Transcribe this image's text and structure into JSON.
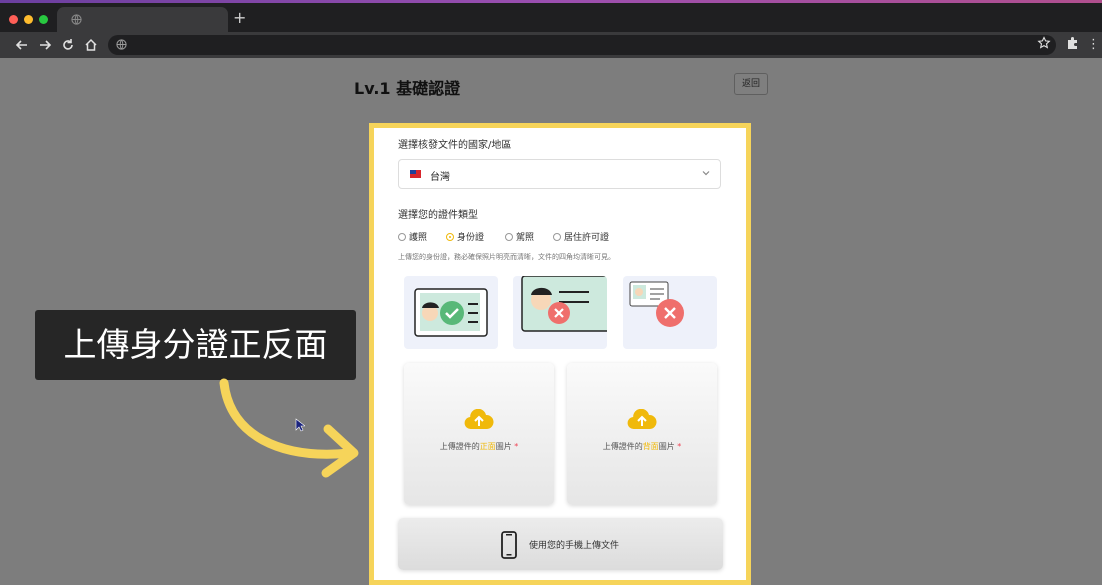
{
  "browser": {
    "tab_title": "",
    "new_tab_label": "+",
    "url": ""
  },
  "page": {
    "title": "Lv.1 基礎認證",
    "back_label": "返回"
  },
  "form": {
    "country_label": "選擇核發文件的國家/地區",
    "country_value": "台灣",
    "doc_type_label": "選擇您的證件類型",
    "doc_types": [
      "護照",
      "身份證",
      "駕照",
      "居住許可證"
    ],
    "selected_doc_type": "身份證",
    "hint": "上傳您的身份證，務必確保照片明亮而清晰，文件的四角均清晰可見。",
    "upload_front": {
      "prefix": "上傳證件的",
      "highlight": "正面",
      "suffix": "圖片",
      "required": "*"
    },
    "upload_back": {
      "prefix": "上傳證件的",
      "highlight": "背面",
      "suffix": "圖片",
      "required": "*"
    },
    "phone_upload_label": "使用您的手機上傳文件"
  },
  "annotation": {
    "caption": "上傳身分證正反面"
  },
  "colors": {
    "accent": "#f0b90b",
    "highlight_border": "#f6d45a",
    "error": "#ef6f6c",
    "ok": "#58b878"
  }
}
